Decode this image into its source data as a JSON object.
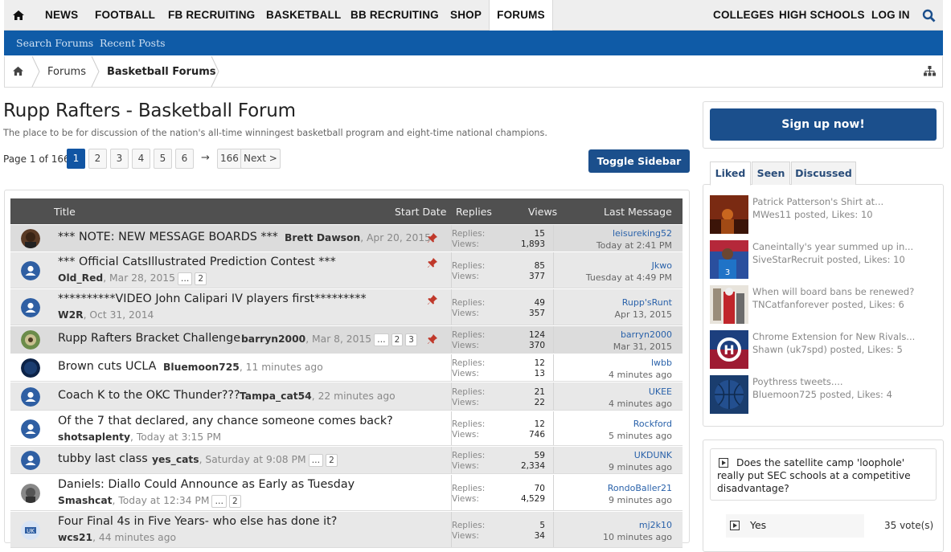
{
  "nav": {
    "items": [
      "NEWS",
      "FOOTBALL",
      "FB RECRUITING",
      "BASKETBALL",
      "BB RECRUITING",
      "SHOP",
      "FORUMS"
    ],
    "right": [
      "COLLEGES",
      "HIGH SCHOOLS",
      "LOG IN"
    ]
  },
  "subnav": {
    "search": "Search Forums",
    "recent": "Recent Posts"
  },
  "breadcrumb": {
    "forums": "Forums",
    "current": "Basketball Forums"
  },
  "forum": {
    "title": "Rupp Rafters - Basketball Forum",
    "description": "The place to be for discussion of the nation's all-time winningest basketball program and eight-time national champions."
  },
  "pager": {
    "label": "Page 1 of 166",
    "pages": [
      "1",
      "2",
      "3",
      "4",
      "5",
      "6"
    ],
    "arrow": "→",
    "last": "166",
    "next": "Next >"
  },
  "toggle_sidebar": "Toggle Sidebar",
  "columns": {
    "title": "Title",
    "start_date": "Start Date",
    "replies": "Replies",
    "views": "Views",
    "last_message": "Last Message ↓"
  },
  "stat_labels": {
    "replies": "Replies:",
    "views": "Views:"
  },
  "threads": [
    {
      "title": "*** NOTE: NEW MESSAGE BOARDS ***",
      "starter": "Brett Dawson",
      "date": ", Apr 20, 2015",
      "pages": [],
      "sticky": true,
      "replies": "15",
      "views": "1,893",
      "last_user": "leisureking52",
      "last_date": "Today at 2:41 PM"
    },
    {
      "title": "*** Official CatsIllustrated Prediction Contest ***",
      "starter": "Old_Red",
      "date": ", Mar 28, 2015",
      "pages": [
        "…",
        "2"
      ],
      "sticky": true,
      "replies": "85",
      "views": "377",
      "last_user": "Jkwo",
      "last_date": "Tuesday at 4:49 PM"
    },
    {
      "title": "**********VIDEO John Calipari IV players first*********",
      "starter": "W2R",
      "date": ", Oct 31, 2014",
      "pages": [],
      "sticky": true,
      "replies": "49",
      "views": "357",
      "last_user": "Rupp'sRunt",
      "last_date": "Apr 13, 2015"
    },
    {
      "title": "Rupp Rafters Bracket Challenge",
      "starter": "barryn2000",
      "date": ", Mar 8, 2015",
      "pages": [
        "…",
        "2",
        "3"
      ],
      "sticky": true,
      "replies": "124",
      "views": "370",
      "last_user": "barryn2000",
      "last_date": "Mar 31, 2015"
    },
    {
      "title": "Brown cuts UCLA",
      "starter": "Bluemoon725",
      "date": ", 11 minutes ago",
      "pages": [],
      "sticky": false,
      "replies": "12",
      "views": "13",
      "last_user": "lwbb",
      "last_date": "4 minutes ago"
    },
    {
      "title": "Coach K to the OKC Thunder???",
      "starter": "Tampa_cat54",
      "date": ", 22 minutes ago",
      "pages": [],
      "sticky": false,
      "replies": "21",
      "views": "22",
      "last_user": "UKEE",
      "last_date": "4 minutes ago"
    },
    {
      "title": "Of the 7 that declared, any chance someone comes back?",
      "starter": "shotsaplenty",
      "date": ", Today at 3:15 PM",
      "pages": [],
      "sticky": false,
      "replies": "12",
      "views": "746",
      "last_user": "Rockford",
      "last_date": "5 minutes ago"
    },
    {
      "title": "tubby last class",
      "starter": "yes_cats",
      "date": ", Saturday at 9:08 PM",
      "pages": [
        "…",
        "2"
      ],
      "sticky": false,
      "replies": "59",
      "views": "2,334",
      "last_user": "UKDUNK",
      "last_date": "9 minutes ago"
    },
    {
      "title": "Daniels: Diallo Could Announce as Early as Tuesday",
      "starter": "Smashcat",
      "date": ", Today at 12:34 PM",
      "pages": [
        "…",
        "2"
      ],
      "sticky": false,
      "replies": "70",
      "views": "4,529",
      "last_user": "RondoBaller21",
      "last_date": "9 minutes ago"
    },
    {
      "title": "Four Final 4s in Five Years- who else has done it?",
      "starter": "wcs21",
      "date": ", 44 minutes ago",
      "pages": [],
      "sticky": false,
      "replies": "5",
      "views": "34",
      "last_user": "mj2k10",
      "last_date": "10 minutes ago"
    }
  ],
  "sidebar": {
    "signup": "Sign up now!",
    "tabs": [
      "Liked",
      "Seen",
      "Discussed"
    ],
    "liked": [
      {
        "title": "Patrick Patterson's Shirt at...",
        "meta": "MWes11 posted, Likes: 10"
      },
      {
        "title": "Caneintally's year summed up in...",
        "meta": "SiveStarRecruit posted, Likes: 10"
      },
      {
        "title": "When will board bans be renewed?",
        "meta": "TNCatfanforever posted, Likes: 6"
      },
      {
        "title": "Chrome Extension for New Rivals...",
        "meta": "Shawn (uk7spd) posted, Likes: 5"
      },
      {
        "title": "Poythress tweets....",
        "meta": "Bluemoon725 posted, Likes: 4"
      }
    ],
    "poll": {
      "question": "Does the satellite camp 'loophole' really put SEC schools at a competitive disadvantage?",
      "option": "Yes",
      "votes": "35 vote(s)"
    }
  },
  "colors": {
    "nav_blue": "#0f5ba7",
    "button_blue": "#1b4f8c",
    "header_gray": "#505050",
    "link_blue": "#2a62aa"
  }
}
